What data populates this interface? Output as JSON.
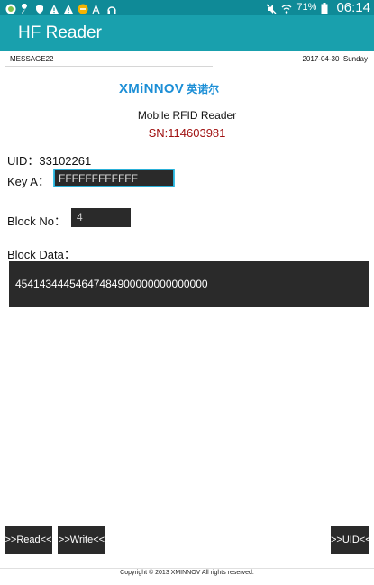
{
  "status_bar": {
    "left_icons": [
      "android-icon",
      "wrench-icon",
      "shield-icon",
      "warning-icon",
      "warning-icon",
      "minus-circle-icon",
      "text-size-icon",
      "headphones-icon"
    ],
    "right_icons": [
      "mute-icon",
      "wifi-icon",
      "battery-icon"
    ],
    "battery_percent": "71%",
    "time": "06:14"
  },
  "app_bar": {
    "title": "HF Reader"
  },
  "message_bar": {
    "message": "MESSAGE22",
    "date": "2017-04-30",
    "day": "Sunday"
  },
  "brand": {
    "logo_latin": "XMiNNOV",
    "logo_cn": "英诺尔",
    "device_name": "Mobile RFID Reader",
    "serial": "SN:114603981"
  },
  "form": {
    "uid_label": "UID：",
    "uid_value": "33102261",
    "key_a_label": "Key A：",
    "key_a_value": "FFFFFFFFFFFF",
    "block_no_label": "Block No：",
    "block_no_value": "4",
    "block_data_label": "Block Data：",
    "block_data_value": "45414344454647484900000000000000"
  },
  "buttons": {
    "read": ">>Read<<",
    "write": ">>Write<<",
    "uid": ">>UID<<"
  },
  "footer": {
    "copyright": "Copyright © 2013 XMINNOV All rights reserved."
  },
  "colors": {
    "status_bar": "#0f8a97",
    "app_bar": "#19a0ad",
    "serial_text": "#a01010",
    "logo": "#1d8fd6",
    "field_bg": "#2a2a2a",
    "focus_border": "#2ab0d8"
  }
}
